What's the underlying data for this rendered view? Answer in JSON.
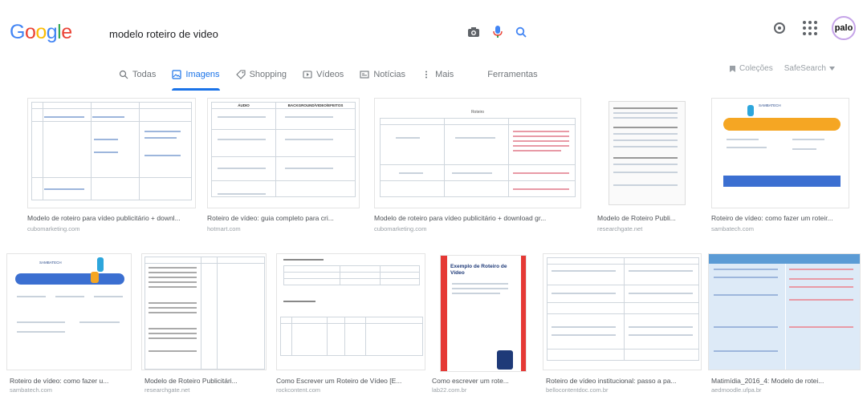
{
  "header": {
    "logo_text": "Google",
    "search_query": "modelo roteiro de video",
    "avatar_text": "palo"
  },
  "tabs": [
    {
      "label": "Todas",
      "icon": "search-icon",
      "active": false
    },
    {
      "label": "Imagens",
      "icon": "image-icon",
      "active": true
    },
    {
      "label": "Shopping",
      "icon": "tag-icon",
      "active": false
    },
    {
      "label": "Vídeos",
      "icon": "video-icon",
      "active": false
    },
    {
      "label": "Notícias",
      "icon": "newspaper-icon",
      "active": false
    },
    {
      "label": "Mais",
      "icon": "more-vert-icon",
      "active": false
    },
    {
      "label": "Ferramentas",
      "icon": "",
      "active": false
    }
  ],
  "tabs_right": {
    "collections": "Coleções",
    "safesearch": "SafeSearch"
  },
  "results_row1": [
    {
      "title": "Modelo de roteiro para vídeo publicitário + downl...",
      "source": "cubomarketing.com"
    },
    {
      "title": "Roteiro de vídeo: guia completo para cri...",
      "source": "hotmart.com"
    },
    {
      "title": "Modelo de roteiro para vídeo publicitário + download gr...",
      "source": "cubomarketing.com"
    },
    {
      "title": "Modelo de Roteiro Publi...",
      "source": "researchgate.net"
    },
    {
      "title": "Roteiro de vídeo: como fazer um roteir...",
      "source": "sambatech.com"
    }
  ],
  "results_row2": [
    {
      "title": "Roteiro de vídeo: como fazer u...",
      "source": "sambatech.com"
    },
    {
      "title": "Modelo de Roteiro Publicitári...",
      "source": "researchgate.net"
    },
    {
      "title": "Como Escrever um Roteiro de Vídeo [E...",
      "source": "rockcontent.com"
    },
    {
      "title": "Como escrever um rote...",
      "source": "lab22.com.br"
    },
    {
      "title": "Roteiro de vídeo institucional: passo a pa...",
      "source": "bellocontentdoc.com.br"
    },
    {
      "title": "Matimídia_2016_4: Modelo de rotei...",
      "source": "aedmoodle.ufpa.br"
    }
  ],
  "thumb_text": {
    "audio": "ÁUDIO",
    "bg": "BACKGROUND/VIDEO/EFEITOS",
    "roteiro": "Roteiro",
    "sambatech": "SAMBATECH",
    "exemplo": "Exemplo de Roteiro de Vídeo"
  }
}
